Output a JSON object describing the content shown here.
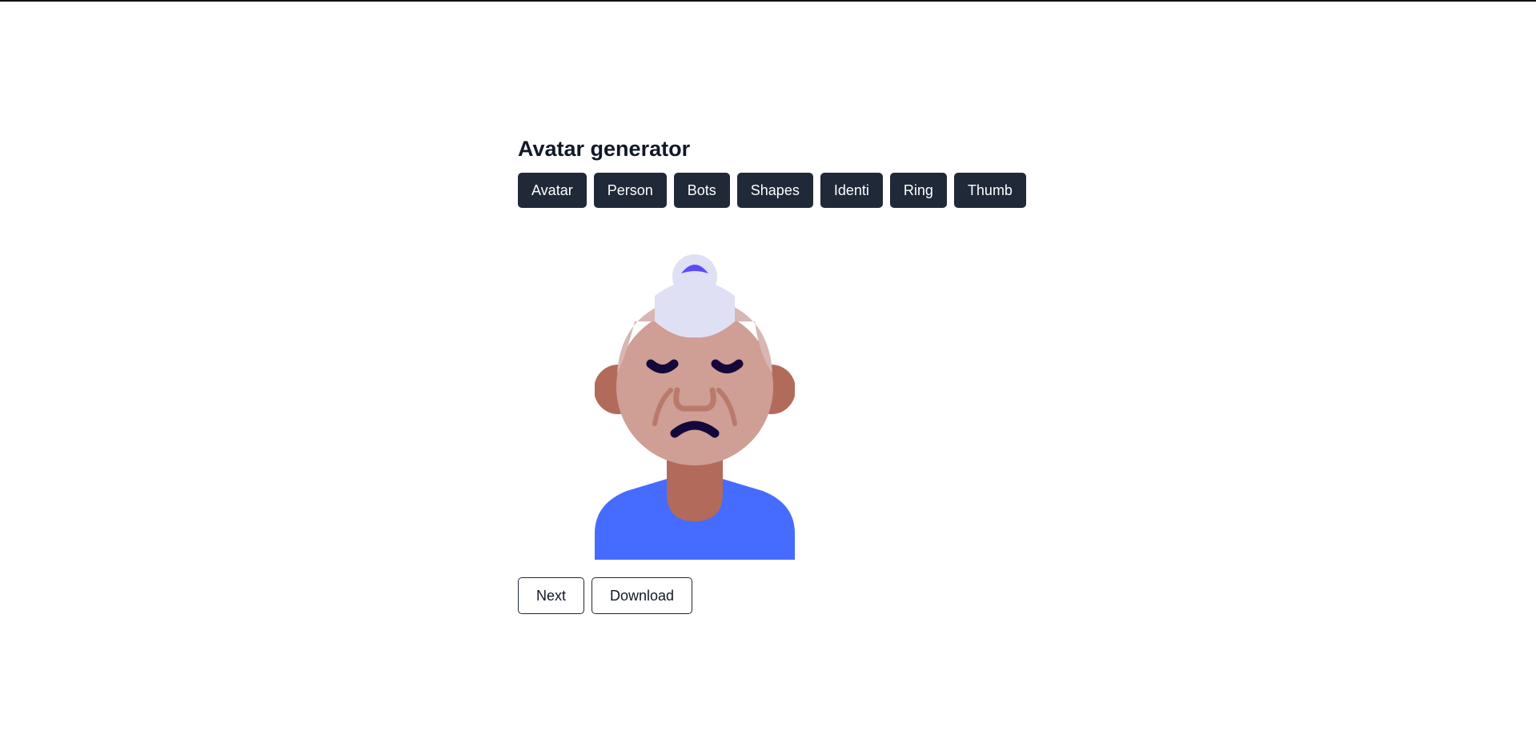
{
  "page": {
    "title": "Avatar generator"
  },
  "tabs": [
    {
      "label": "Avatar"
    },
    {
      "label": "Person"
    },
    {
      "label": "Bots"
    },
    {
      "label": "Shapes"
    },
    {
      "label": "Identi"
    },
    {
      "label": "Ring"
    },
    {
      "label": "Thumb"
    }
  ],
  "actions": {
    "next_label": "Next",
    "download_label": "Download"
  },
  "colors": {
    "tab_background": "#1f2937",
    "skin": "#cf9e95",
    "ear_neck": "#b26b5b",
    "hair": "#dfe0f4",
    "hair_band": "#5b4cf7",
    "shirt": "#466bff",
    "features": "#14073a"
  }
}
